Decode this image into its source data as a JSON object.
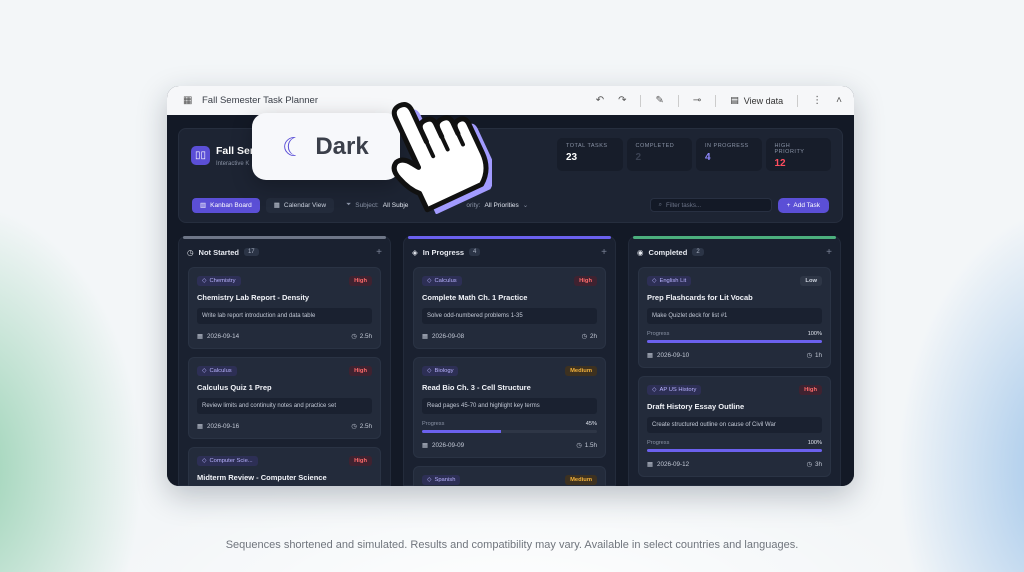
{
  "window": {
    "title": "Fall Semester Task Planner",
    "view_data_label": "View data"
  },
  "app": {
    "title": "Fall Seme",
    "subtitle": "Interactive K",
    "stats": [
      {
        "label": "TOTAL TASKS",
        "value": "23",
        "color": "#ffffff"
      },
      {
        "label": "COMPLETED",
        "value": "2",
        "color": "#3a4152"
      },
      {
        "label": "IN PROGRESS",
        "value": "4",
        "color": "#8f88ff"
      },
      {
        "label": "HIGH PRIORITY",
        "value": "12",
        "color": "#ff4d5e"
      }
    ],
    "toolbar": {
      "kanban": "Kanban Board",
      "calendar": "Calendar View",
      "subject_label": "Subject:",
      "subject_value": "All Subje",
      "priority_label": "ority:",
      "priority_value": "All Priorities",
      "search_placeholder": "Filter tasks...",
      "add_task": "Add Task"
    }
  },
  "columns": [
    {
      "title": "Not Started",
      "count": "17",
      "accent": "#6e7687",
      "cards": [
        {
          "tag": "Chemistry",
          "priority": "High",
          "ptype": "high",
          "title": "Chemistry Lab Report - Density",
          "note": "Write lab report introduction and data table",
          "due": "2026-09-14",
          "est": "2.5h"
        },
        {
          "tag": "Calculus",
          "priority": "High",
          "ptype": "high",
          "title": "Calculus Quiz 1 Prep",
          "note": "Review limits and continuity notes and practice set",
          "due": "2026-09-16",
          "est": "2.5h"
        },
        {
          "tag": "Computer Scie...",
          "priority": "High",
          "ptype": "high",
          "title": "Midterm Review - Computer Science",
          "note": "",
          "due": "",
          "est": ""
        }
      ]
    },
    {
      "title": "In Progress",
      "count": "4",
      "accent": "#6b61ee",
      "cards": [
        {
          "tag": "Calculus",
          "priority": "High",
          "ptype": "high",
          "title": "Complete Math Ch. 1 Practice",
          "note": "Solve odd-numbered problems 1-35",
          "due": "2026-09-08",
          "est": "2h"
        },
        {
          "tag": "Biology",
          "priority": "Medium",
          "ptype": "medium",
          "title": "Read Bio Ch. 3 - Cell Structure",
          "note": "Read pages 45-70 and highlight key terms",
          "progress_label": "Progress",
          "progress": "45%",
          "progress_value": 45,
          "due": "2026-09-09",
          "est": "1.5h"
        },
        {
          "tag": "Spanish",
          "priority": "Medium",
          "ptype": "medium",
          "title": "",
          "note": "",
          "due": "",
          "est": ""
        }
      ]
    },
    {
      "title": "Completed",
      "count": "2",
      "accent": "#4caf7d",
      "cards": [
        {
          "tag": "English Lit",
          "priority": "Low",
          "ptype": "low",
          "title": "Prep Flashcards for Lit Vocab",
          "note": "Make Quizlet deck for list #1",
          "progress_label": "Progress",
          "progress": "100%",
          "progress_value": 100,
          "due": "2026-09-10",
          "est": "1h"
        },
        {
          "tag": "AP US History",
          "priority": "High",
          "ptype": "high",
          "title": "Draft History Essay Outline",
          "note": "Create structured outline on cause of Civil War",
          "progress_label": "Progress",
          "progress": "100%",
          "progress_value": 100,
          "due": "2026-09-12",
          "est": "3h"
        }
      ]
    }
  ],
  "overlay": {
    "label": "Dark",
    "icon": "moon-icon"
  },
  "disclaimer": "Sequences shortened and simulated. Results and compatibility may vary. Available in select countries and languages."
}
